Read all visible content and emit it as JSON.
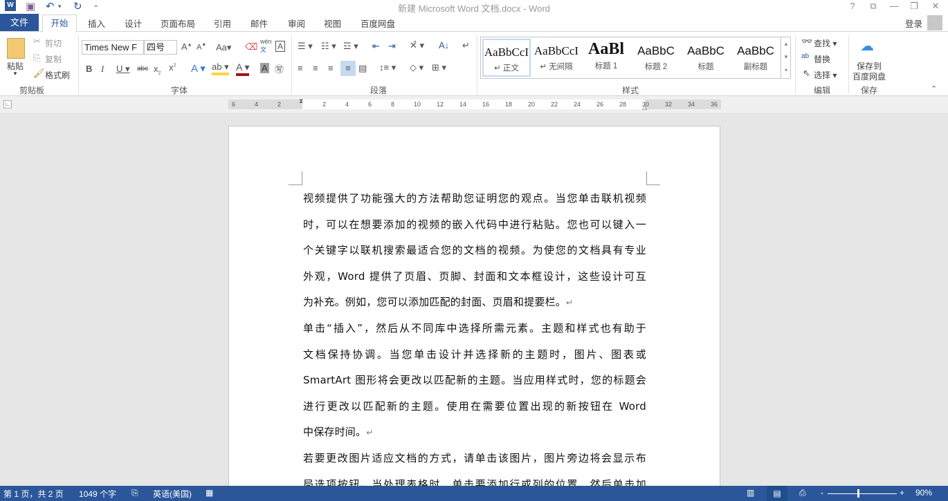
{
  "window": {
    "title": "新建 Microsoft Word 文档.docx - Word",
    "login": "登录"
  },
  "quick_access": {
    "word_icon": "W",
    "save": "save-icon",
    "undo": "undo-icon",
    "redo": "redo-icon",
    "customize": "⌄"
  },
  "window_controls": [
    "?",
    "⧉",
    "—",
    "❐",
    "✕"
  ],
  "tabs": {
    "file": "文件",
    "home": "开始",
    "others": [
      "插入",
      "设计",
      "页面布局",
      "引用",
      "邮件",
      "审阅",
      "视图",
      "百度网盘"
    ]
  },
  "clipboard": {
    "paste": "粘贴",
    "cut": "剪切",
    "copy": "复制",
    "format_painter": "格式刷",
    "label": "剪贴板"
  },
  "font": {
    "name": "Times New F",
    "size": "四号",
    "label": "字体",
    "wen": "wén",
    "wen2": "文"
  },
  "paragraph": {
    "label": "段落"
  },
  "styles": {
    "label": "样式",
    "items": [
      {
        "sample": "AaBbCcI",
        "name": "↵ 正文"
      },
      {
        "sample": "AaBbCcI",
        "name": "↵ 无间隔"
      },
      {
        "sample": "AaBl",
        "name": "标题 1"
      },
      {
        "sample": "AaBbC",
        "name": "标题 2"
      },
      {
        "sample": "AaBbC",
        "name": "标题"
      },
      {
        "sample": "AaBbC",
        "name": "副标题"
      }
    ]
  },
  "editing": {
    "find": "查找",
    "replace": "替换",
    "select": "选择",
    "label": "编辑"
  },
  "save_group": {
    "button": "保存到",
    "button2": "百度网盘",
    "label": "保存"
  },
  "ruler": {
    "left_marks": [
      "6",
      "4",
      "2"
    ],
    "marks": [
      "2",
      "4",
      "6",
      "8",
      "10",
      "12",
      "14",
      "16",
      "18",
      "20",
      "22",
      "24",
      "26",
      "28",
      "30",
      "32",
      "34",
      "36"
    ]
  },
  "document": {
    "lines": [
      "视频提供了功能强大的方法帮助您证明您的观点。当您单击联机视频",
      "时，可以在想要添加的视频的嵌入代码中进行粘贴。您也可以键入一",
      "个关键字以联机搜索最适合您的文档的视频。为使您的文档具有专业",
      "外观，Word 提供了页眉、页脚、封面和文本框设计，这些设计可互",
      "为补充。例如，您可以添加匹配的封面、页眉和提要栏。",
      "单击“插入”，然后从不同库中选择所需元素。主题和样式也有助于",
      "文档保持协调。当您单击设计并选择新的主题时，图片、图表或",
      "SmartArt 图形将会更改以匹配新的主题。当应用样式时，您的标题会",
      "进行更改以匹配新的主题。使用在需要位置出现的新按钮在 Word",
      "中保存时间。",
      "若要更改图片适应文档的方式，请单击该图片，图片旁边将会显示布",
      "局选项按钮。当处理表格时，单击要添加行或列的位置，然后单击加"
    ],
    "paragraph_mark": "↵"
  },
  "status": {
    "page": "第 1 页，共 2 页",
    "words": "1049 个字",
    "language": "英语(美国)",
    "zoom": "90%",
    "zoom_percent": 90
  },
  "colors": {
    "accent": "#2b579a"
  }
}
